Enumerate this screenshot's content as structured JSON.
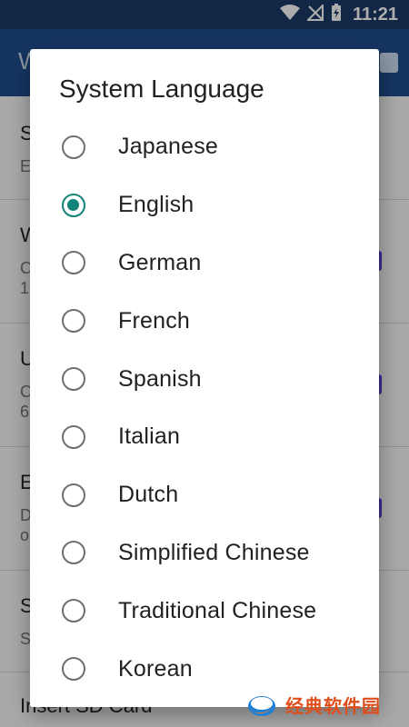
{
  "status_bar": {
    "time": "11:21",
    "icons": [
      "wifi-icon",
      "no-signal-icon",
      "battery-charging-icon"
    ]
  },
  "app_bar": {
    "title": "W",
    "action_icon": "save-icon"
  },
  "background_list": [
    {
      "title": "S",
      "subtitle": "E"
    },
    {
      "title": "W",
      "subtitle": "C\n1"
    },
    {
      "title": "U",
      "subtitle": "C\n6"
    },
    {
      "title": "E",
      "subtitle": "D\no"
    },
    {
      "title": "S",
      "subtitle": "S"
    },
    {
      "title": "Insert SD Card",
      "subtitle": ""
    }
  ],
  "dialog": {
    "title": "System Language",
    "selected": "English",
    "accent_color": "#118377",
    "options": [
      "Japanese",
      "English",
      "German",
      "French",
      "Spanish",
      "Italian",
      "Dutch",
      "Simplified Chinese",
      "Traditional Chinese",
      "Korean"
    ]
  },
  "watermark": {
    "text": "经典软件园"
  }
}
